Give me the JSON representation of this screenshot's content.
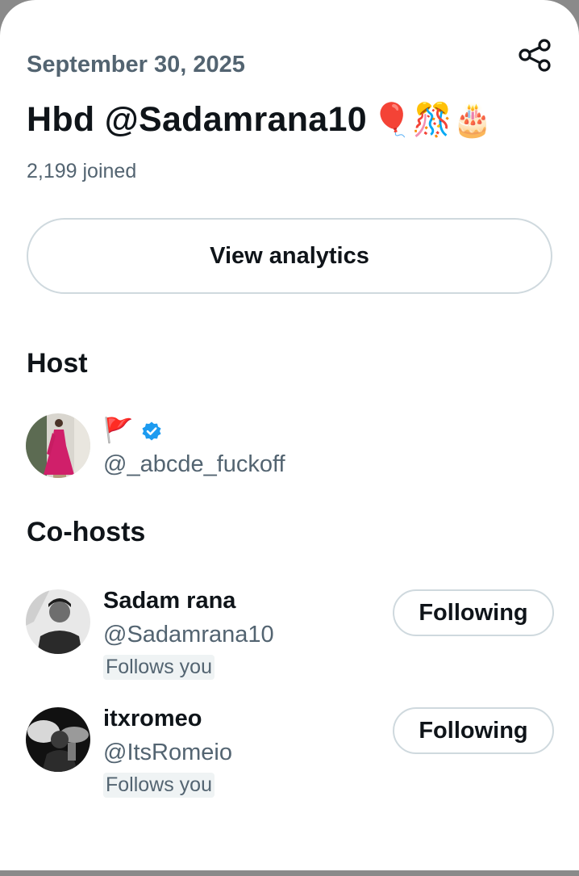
{
  "space": {
    "date": "September 30, 2025",
    "title": "Hbd @Sadamrana10",
    "title_emojis": "🎈🎊🎂",
    "joined": "2,199 joined",
    "analytics_label": "View analytics"
  },
  "host": {
    "section_label": "Host",
    "display_name": "🚩",
    "handle": "@_abcde_fuckoff",
    "verified": true
  },
  "cohosts": {
    "section_label": "Co-hosts",
    "items": [
      {
        "name": "Sadam rana",
        "handle": "@Sadamrana10",
        "follows_label": "Follows you",
        "button_label": "Following"
      },
      {
        "name": "itxromeo",
        "handle": "@ItsRomeio",
        "follows_label": "Follows you",
        "button_label": "Following"
      }
    ]
  },
  "colors": {
    "verified_blue": "#1d9bf0",
    "secondary_text": "#536471",
    "border": "#cfd9de"
  }
}
